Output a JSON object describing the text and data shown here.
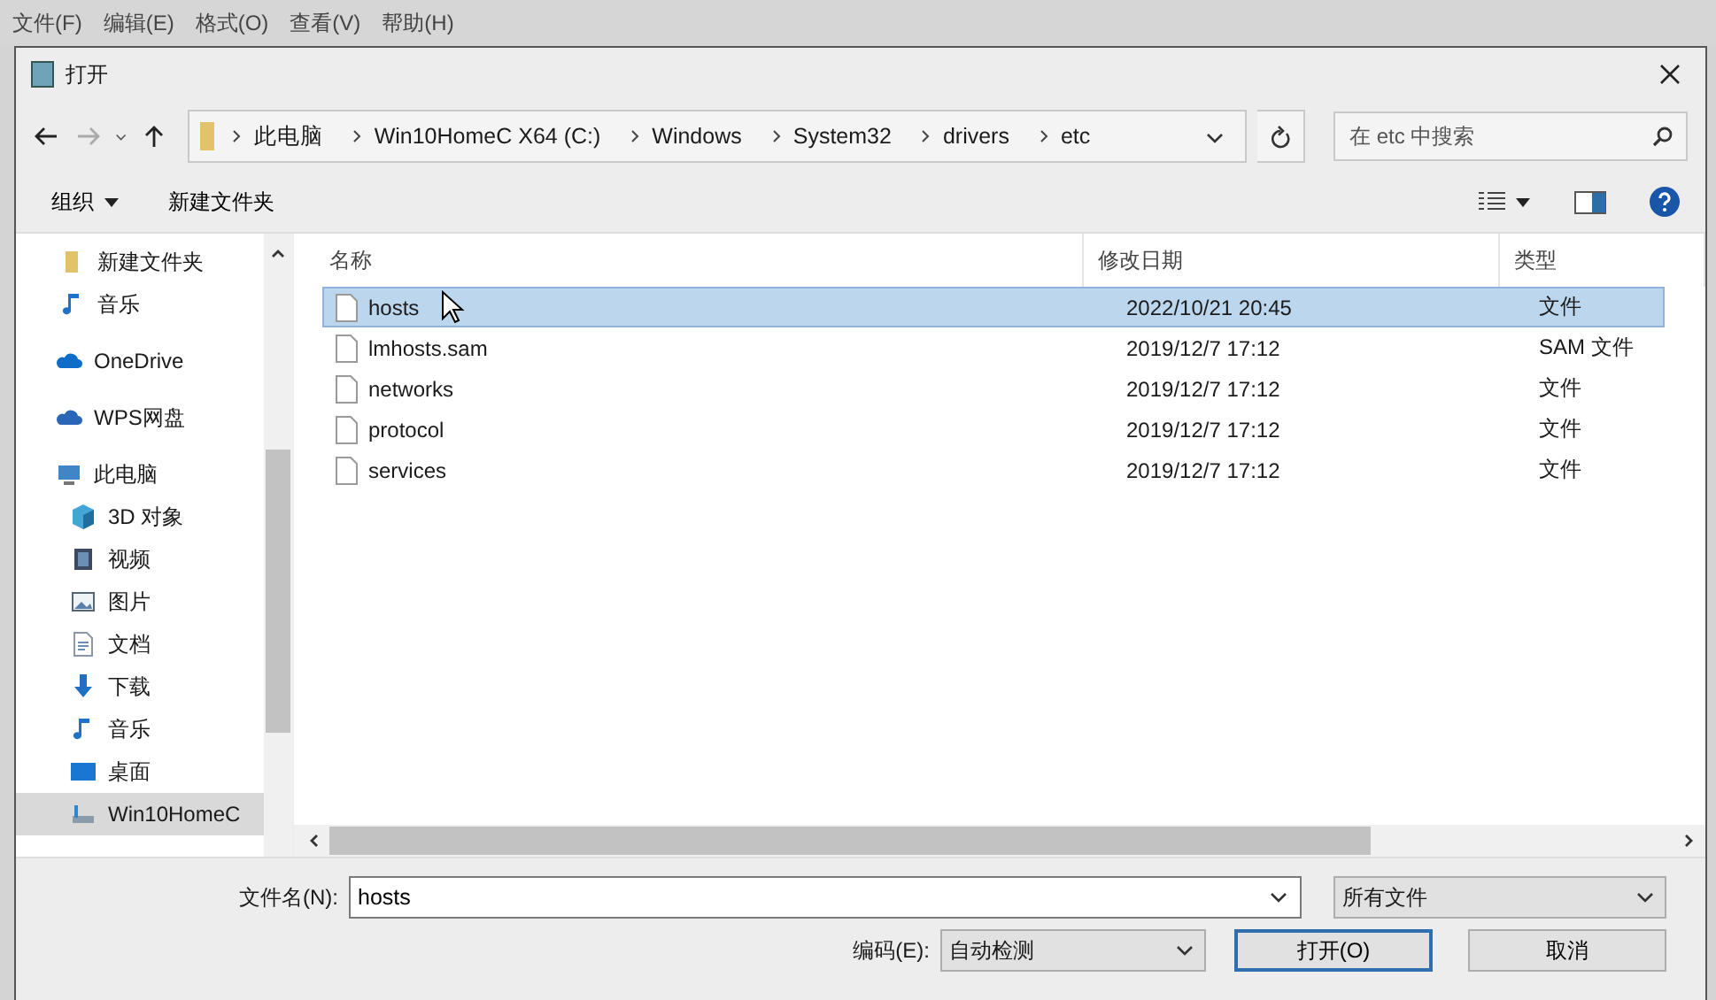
{
  "menu_bar": {
    "items": [
      "文件(F)",
      "编辑(E)",
      "格式(O)",
      "查看(V)",
      "帮助(H)"
    ]
  },
  "window": {
    "title": "打开"
  },
  "address_bar": {
    "crumbs": [
      "此电脑",
      "Win10HomeC X64 (C:)",
      "Windows",
      "System32",
      "drivers",
      "etc"
    ]
  },
  "search": {
    "placeholder": "在 etc 中搜索"
  },
  "toolbar": {
    "organize": "组织",
    "new_folder": "新建文件夹"
  },
  "sidebar": {
    "scrolled_children": [
      {
        "label": "新建文件夹",
        "kind": "folder",
        "selected": false
      },
      {
        "label": "音乐",
        "kind": "music",
        "selected": false
      }
    ],
    "items": [
      {
        "label": "OneDrive",
        "kind": "cloud",
        "selected": false
      },
      {
        "label": "WPS网盘",
        "kind": "cloud2",
        "selected": false
      },
      {
        "label": "此电脑",
        "kind": "pc",
        "selected": false,
        "children": [
          {
            "label": "3D 对象",
            "kind": "cube",
            "selected": false
          },
          {
            "label": "视频",
            "kind": "video",
            "selected": false
          },
          {
            "label": "图片",
            "kind": "picture",
            "selected": false
          },
          {
            "label": "文档",
            "kind": "document",
            "selected": false
          },
          {
            "label": "下载",
            "kind": "download",
            "selected": false
          },
          {
            "label": "音乐",
            "kind": "music",
            "selected": false
          },
          {
            "label": "桌面",
            "kind": "desktop",
            "selected": false
          },
          {
            "label": "Win10HomeC",
            "kind": "drive",
            "selected": true
          }
        ]
      }
    ]
  },
  "table": {
    "columns": [
      "名称",
      "修改日期",
      "类型"
    ],
    "rows": [
      {
        "name": "hosts",
        "date": "2022/10/21 20:45",
        "type": "文件",
        "selected": true
      },
      {
        "name": "lmhosts.sam",
        "date": "2019/12/7 17:12",
        "type": "SAM 文件",
        "selected": false
      },
      {
        "name": "networks",
        "date": "2019/12/7 17:12",
        "type": "文件",
        "selected": false
      },
      {
        "name": "protocol",
        "date": "2019/12/7 17:12",
        "type": "文件",
        "selected": false
      },
      {
        "name": "services",
        "date": "2019/12/7 17:12",
        "type": "文件",
        "selected": false
      }
    ]
  },
  "filename": {
    "label": "文件名(N):",
    "value": "hosts"
  },
  "filetype": {
    "value": "所有文件"
  },
  "encoding": {
    "label": "编码(E):",
    "value": "自动检测"
  },
  "buttons": [
    {
      "label": "打开(O)",
      "kind": "default"
    },
    {
      "label": "取消",
      "kind": "normal"
    }
  ]
}
